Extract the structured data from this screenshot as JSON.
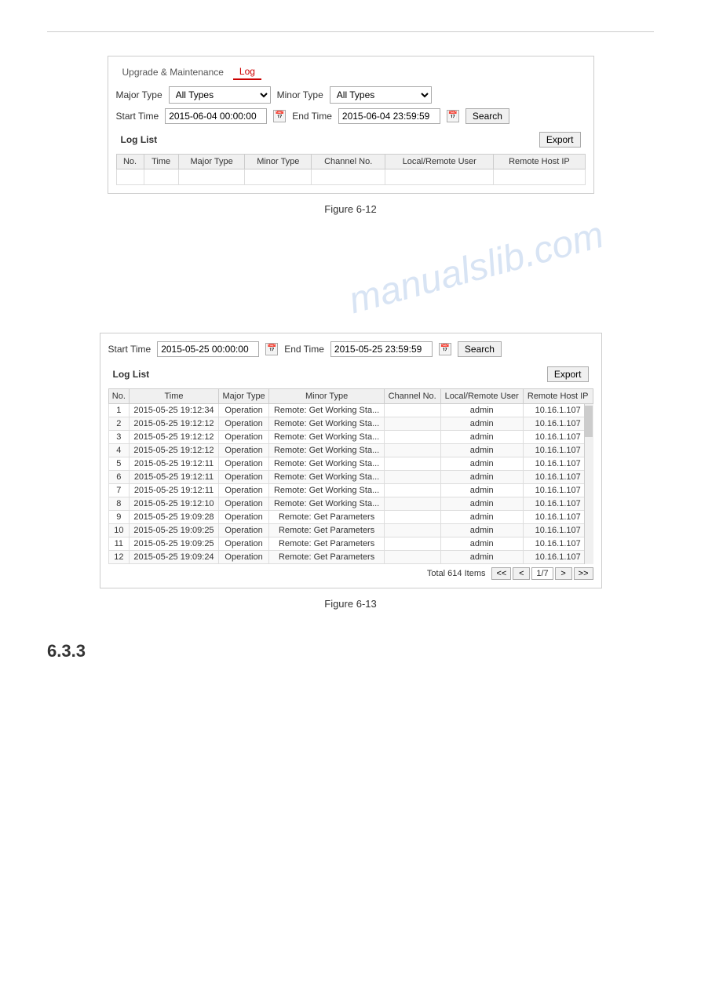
{
  "divider": true,
  "figure12": {
    "caption": "Figure 6-12",
    "tabs": [
      {
        "label": "Upgrade & Maintenance",
        "active": false
      },
      {
        "label": "Log",
        "active": true
      }
    ],
    "form": {
      "major_type_label": "Major Type",
      "major_type_value": "All Types",
      "minor_type_label": "Minor Type",
      "minor_type_value": "All Types",
      "start_time_label": "Start Time",
      "start_time_value": "2015-06-04 00:00:00",
      "end_time_label": "End Time",
      "end_time_value": "2015-06-04 23:59:59",
      "search_label": "Search"
    },
    "log_list": {
      "title": "Log List",
      "export_label": "Export",
      "columns": [
        "No.",
        "Time",
        "Major Type",
        "Minor Type",
        "Channel No.",
        "Local/Remote User",
        "Remote Host IP"
      ],
      "rows": []
    }
  },
  "watermark": "manualslib.com",
  "figure13": {
    "caption": "Figure 6-13",
    "form": {
      "start_time_label": "Start Time",
      "start_time_value": "2015-05-25 00:00:00",
      "end_time_label": "End Time",
      "end_time_value": "2015-05-25 23:59:59",
      "search_label": "Search"
    },
    "log_list": {
      "title": "Log List",
      "export_label": "Export",
      "columns": [
        "No.",
        "Time",
        "Major Type",
        "Minor Type",
        "Channel No.",
        "Local/Remote User",
        "Remote Host IP"
      ],
      "rows": [
        {
          "no": 1,
          "time": "2015-05-25 19:12:34",
          "major": "Operation",
          "minor": "Remote: Get Working Sta...",
          "channel": "",
          "user": "admin",
          "ip": "10.16.1.107"
        },
        {
          "no": 2,
          "time": "2015-05-25 19:12:12",
          "major": "Operation",
          "minor": "Remote: Get Working Sta...",
          "channel": "",
          "user": "admin",
          "ip": "10.16.1.107"
        },
        {
          "no": 3,
          "time": "2015-05-25 19:12:12",
          "major": "Operation",
          "minor": "Remote: Get Working Sta...",
          "channel": "",
          "user": "admin",
          "ip": "10.16.1.107"
        },
        {
          "no": 4,
          "time": "2015-05-25 19:12:12",
          "major": "Operation",
          "minor": "Remote: Get Working Sta...",
          "channel": "",
          "user": "admin",
          "ip": "10.16.1.107"
        },
        {
          "no": 5,
          "time": "2015-05-25 19:12:11",
          "major": "Operation",
          "minor": "Remote: Get Working Sta...",
          "channel": "",
          "user": "admin",
          "ip": "10.16.1.107"
        },
        {
          "no": 6,
          "time": "2015-05-25 19:12:11",
          "major": "Operation",
          "minor": "Remote: Get Working Sta...",
          "channel": "",
          "user": "admin",
          "ip": "10.16.1.107"
        },
        {
          "no": 7,
          "time": "2015-05-25 19:12:11",
          "major": "Operation",
          "minor": "Remote: Get Working Sta...",
          "channel": "",
          "user": "admin",
          "ip": "10.16.1.107"
        },
        {
          "no": 8,
          "time": "2015-05-25 19:12:10",
          "major": "Operation",
          "minor": "Remote: Get Working Sta...",
          "channel": "",
          "user": "admin",
          "ip": "10.16.1.107"
        },
        {
          "no": 9,
          "time": "2015-05-25 19:09:28",
          "major": "Operation",
          "minor": "Remote: Get Parameters",
          "channel": "",
          "user": "admin",
          "ip": "10.16.1.107"
        },
        {
          "no": 10,
          "time": "2015-05-25 19:09:25",
          "major": "Operation",
          "minor": "Remote: Get Parameters",
          "channel": "",
          "user": "admin",
          "ip": "10.16.1.107"
        },
        {
          "no": 11,
          "time": "2015-05-25 19:09:25",
          "major": "Operation",
          "minor": "Remote: Get Parameters",
          "channel": "",
          "user": "admin",
          "ip": "10.16.1.107"
        },
        {
          "no": 12,
          "time": "2015-05-25 19:09:24",
          "major": "Operation",
          "minor": "Remote: Get Parameters",
          "channel": "",
          "user": "admin",
          "ip": "10.16.1.107"
        }
      ],
      "pagination": {
        "total_text": "Total 614 Items",
        "first": "<<",
        "prev": "<",
        "current": "1/7",
        "next": ">",
        "last": ">>"
      }
    }
  },
  "section": {
    "number": "6.3.3"
  }
}
